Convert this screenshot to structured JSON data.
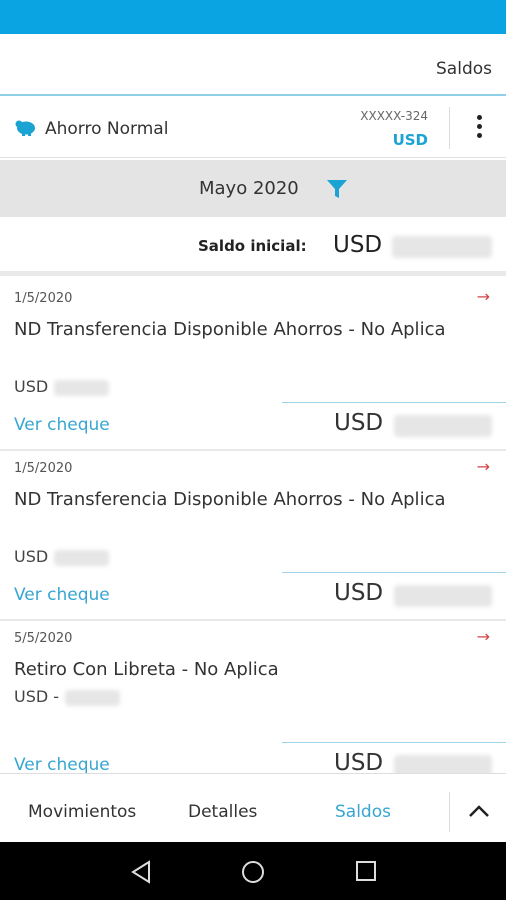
{
  "header": {
    "title": "Saldos"
  },
  "account": {
    "name": "Ahorro Normal",
    "number": "XXXXX-324",
    "currency": "USD",
    "icon": "piggy-bank-icon",
    "menu_icon": "more-vert-icon"
  },
  "filter": {
    "month": "Mayo 2020",
    "icon": "filter-icon"
  },
  "saldo_inicial": {
    "label": "Saldo inicial:",
    "currency": "USD"
  },
  "transactions": [
    {
      "date": "1/5/2020",
      "description": "ND Transferencia Disponible Ahorros - No Aplica",
      "amount_prefix": "USD",
      "link": "Ver cheque",
      "balance_currency": "USD"
    },
    {
      "date": "1/5/2020",
      "description": "ND Transferencia Disponible Ahorros - No Aplica",
      "amount_prefix": "USD",
      "link": "Ver cheque",
      "balance_currency": "USD"
    },
    {
      "date": "5/5/2020",
      "description": "Retiro Con Libreta - No Aplica",
      "amount_prefix": "USD -",
      "link": "Ver cheque",
      "balance_currency": "USD"
    }
  ],
  "tabs": [
    {
      "label": "Movimientos"
    },
    {
      "label": "Detalles"
    },
    {
      "label": "Saldos"
    }
  ],
  "colors": {
    "accent": "#1ba3d4",
    "status_bar": "#0aa4e2",
    "arrow": "#d0454c"
  }
}
